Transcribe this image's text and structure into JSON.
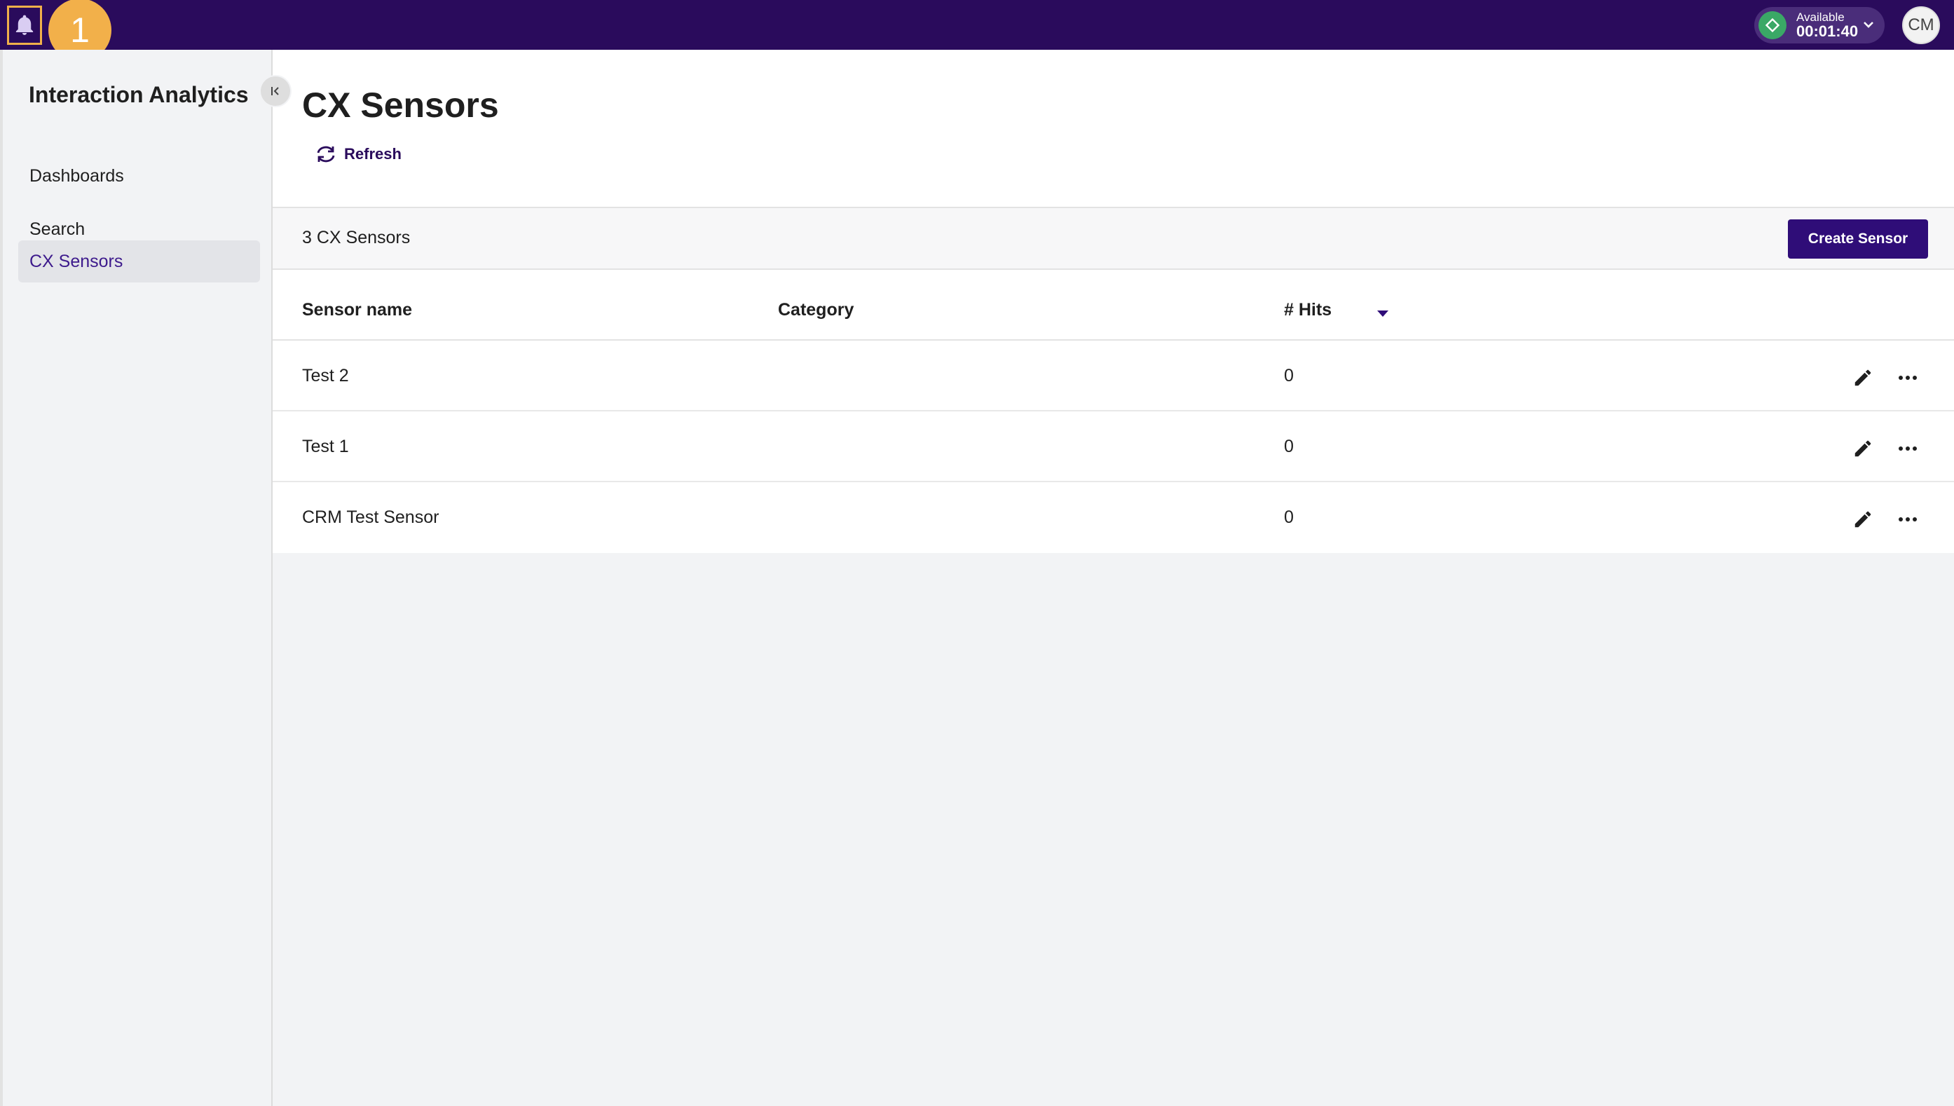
{
  "topbar": {
    "step_number": "1",
    "status": {
      "label": "Available",
      "timer": "00:01:40",
      "color": "#3aa866"
    },
    "avatar_initials": "CM",
    "accent": "#2a0b5c"
  },
  "sidebar": {
    "app_title": "Interaction Analytics",
    "items": [
      {
        "label": "Dashboards",
        "active": false
      },
      {
        "label": "Search",
        "active": false
      },
      {
        "label": "CX Sensors",
        "active": true
      }
    ]
  },
  "main": {
    "page_title": "CX Sensors",
    "refresh_label": "Refresh",
    "count_text": "3 CX Sensors",
    "create_label": "Create Sensor",
    "columns": {
      "name": "Sensor name",
      "category": "Category",
      "hits": "# Hits"
    },
    "rows": [
      {
        "name": "Test 2",
        "category": "",
        "hits": "0"
      },
      {
        "name": "Test 1",
        "category": "",
        "hits": "0"
      },
      {
        "name": "CRM Test Sensor",
        "category": "",
        "hits": "0"
      }
    ]
  }
}
